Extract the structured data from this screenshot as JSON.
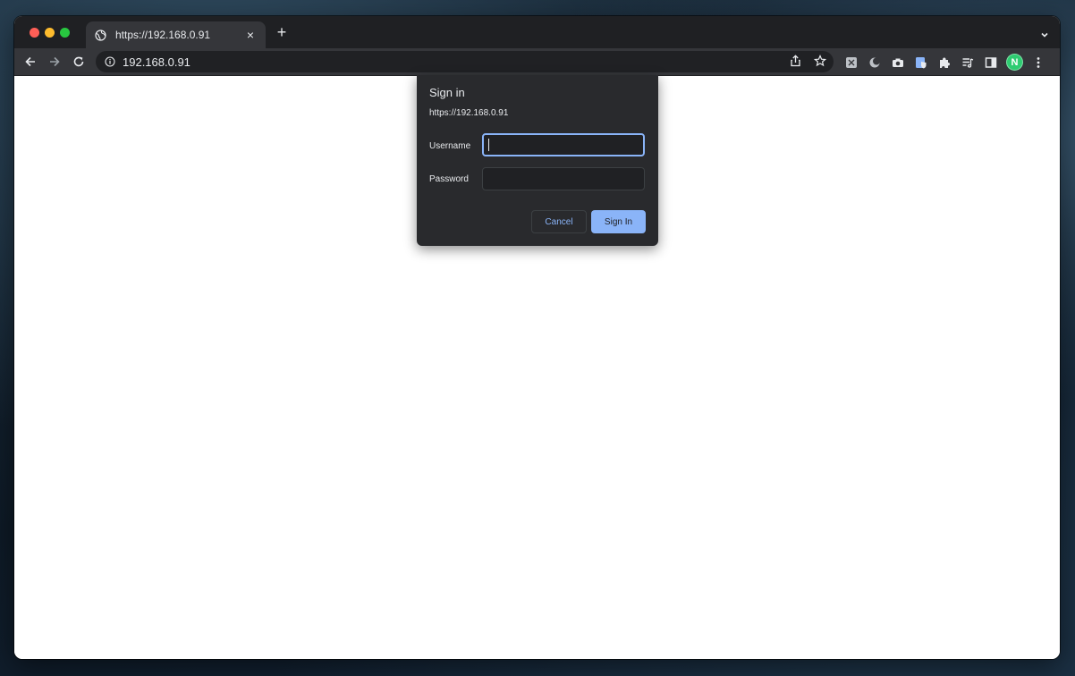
{
  "browser": {
    "tab": {
      "title": "https://192.168.0.91",
      "close_label": "×"
    },
    "new_tab_label": "+",
    "address_bar": {
      "url": "192.168.0.91"
    },
    "profile_initial": "N"
  },
  "dialog": {
    "title": "Sign in",
    "origin": "https://192.168.0.91",
    "username_label": "Username",
    "username_value": "",
    "password_label": "Password",
    "password_value": "",
    "cancel_label": "Cancel",
    "signin_label": "Sign In"
  },
  "icons": {
    "window_controls": [
      "close-dot",
      "minimize-dot",
      "maximize-dot"
    ],
    "tab_favicon": "globe-icon",
    "tab_list": "chevron-down-icon",
    "navigation": [
      "back-arrow-icon",
      "forward-arrow-icon",
      "reload-icon"
    ],
    "security": "info-icon",
    "omnibox_actions": [
      "share-icon",
      "bookmark-star-icon"
    ],
    "extensions": [
      "extension-square-icon",
      "extension-moon-icon",
      "camera-icon",
      "extension-shield-icon",
      "puzzle-icon",
      "reading-list-icon",
      "side-panel-icon"
    ],
    "menu": "kebab-menu-icon"
  },
  "colors": {
    "accent": "#8ab4f8",
    "dialog_bg": "#292a2d",
    "toolbar_bg": "#35363a",
    "tabstrip_bg": "#1f2023",
    "profile": "#2ecc71"
  }
}
